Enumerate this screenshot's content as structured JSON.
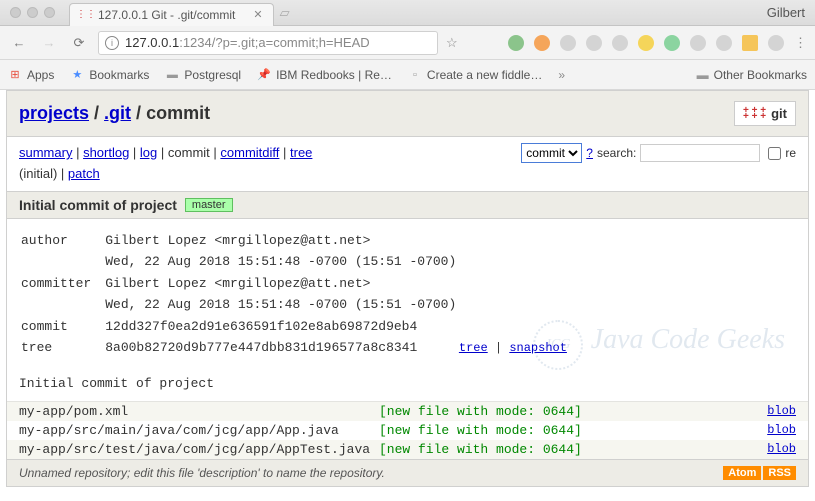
{
  "browser": {
    "profile": "Gilbert",
    "tab_title": "127.0.0.1 Git - .git/commit",
    "url_host": "127.0.0.1",
    "url_port": ":1234",
    "url_path": "/?p=.git;a=commit;h=HEAD"
  },
  "bookmarks": {
    "apps": "Apps",
    "bookmarks": "Bookmarks",
    "postgresql": "Postgresql",
    "ibm": "IBM Redbooks | Re…",
    "fiddle": "Create a new fiddle…",
    "other": "Other Bookmarks"
  },
  "breadcrumb": {
    "projects": "projects",
    "repo": ".git",
    "action": "commit",
    "git_label": "git"
  },
  "nav": {
    "summary": "summary",
    "shortlog": "shortlog",
    "log": "log",
    "commit": "commit",
    "commitdiff": "commitdiff",
    "tree": "tree",
    "initial": "(initial)",
    "patch": "patch"
  },
  "search": {
    "select": "commit",
    "q": "?",
    "label": "search:",
    "re": "re"
  },
  "commit": {
    "title": "Initial commit of project",
    "branch": "master",
    "author_label": "author",
    "author_name": "Gilbert Lopez <mrgillopez@att.net>",
    "author_date": "Wed, 22 Aug 2018 15:51:48 -0700 (15:51 -0700)",
    "committer_label": "committer",
    "committer_name": "Gilbert Lopez <mrgillopez@att.net>",
    "committer_date": "Wed, 22 Aug 2018 15:51:48 -0700 (15:51 -0700)",
    "commit_label": "commit",
    "commit_hash": "12dd327f0ea2d91e636591f102e8ab69872d9eb4",
    "tree_label": "tree",
    "tree_hash": "8a00b82720d9b777e447dbb831d196577a8c8341",
    "tree_link": "tree",
    "snapshot_link": "snapshot",
    "message": "Initial commit of project"
  },
  "files": [
    {
      "path": "my-app/pom.xml",
      "mode": "[new file with mode: 0644]",
      "link": "blob"
    },
    {
      "path": "my-app/src/main/java/com/jcg/app/App.java",
      "mode": "[new file with mode: 0644]",
      "link": "blob"
    },
    {
      "path": "my-app/src/test/java/com/jcg/app/AppTest.java",
      "mode": "[new file with mode: 0644]",
      "link": "blob"
    }
  ],
  "footer": {
    "desc": "Unnamed repository; edit this file 'description' to name the repository.",
    "atom": "Atom",
    "rss": "RSS"
  },
  "watermark": "Java Code Geeks"
}
